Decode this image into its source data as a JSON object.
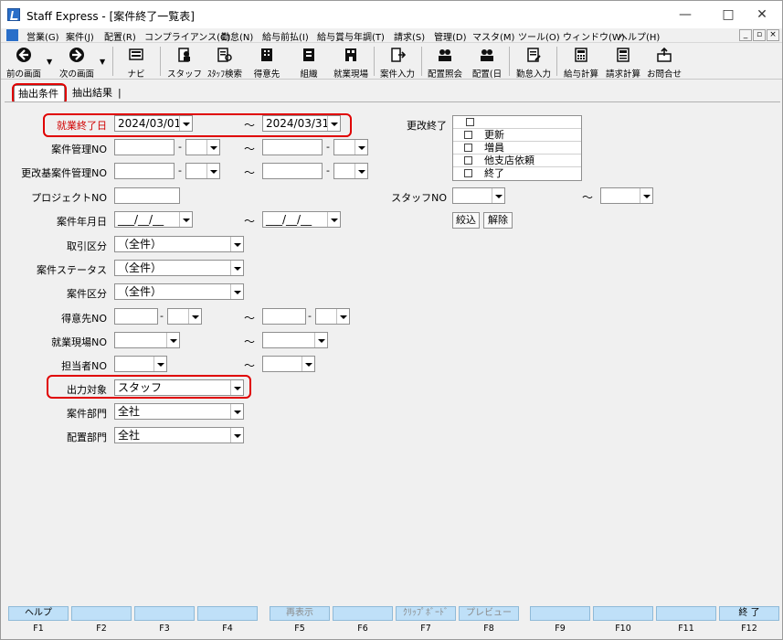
{
  "window": {
    "title": "Staff Express - [案件終了一覧表]"
  },
  "menu": [
    "営業(G)",
    "案件(J)",
    "配置(R)",
    "コンプライアンス(C)",
    "勤怠(N)",
    "給与前払(I)",
    "給与賞与年調(T)",
    "請求(S)",
    "管理(D)",
    "マスタ(M)",
    "ツール(O)",
    "ウィンドウ(W)",
    "ヘルプ(H)"
  ],
  "toolbar": [
    {
      "label": "前の画面",
      "icon": "back-arrow-icon"
    },
    {
      "label": "次の画面",
      "icon": "forward-arrow-icon"
    },
    {
      "label": "ナビ",
      "icon": "navi-icon"
    },
    {
      "label": "スタッフ",
      "icon": "staff-icon"
    },
    {
      "label": "ｽﾀｯﾌ検索",
      "icon": "staff-search-icon"
    },
    {
      "label": "得意先",
      "icon": "client-icon"
    },
    {
      "label": "組織",
      "icon": "organization-icon"
    },
    {
      "label": "就業現場",
      "icon": "worksite-icon"
    },
    {
      "label": "案件入力",
      "icon": "project-entry-icon"
    },
    {
      "label": "配置照会",
      "icon": "placement-inquiry-icon"
    },
    {
      "label": "配置(日",
      "icon": "placement-daily-icon"
    },
    {
      "label": "勤怠入力",
      "icon": "attendance-entry-icon"
    },
    {
      "label": "給与計算",
      "icon": "payroll-icon"
    },
    {
      "label": "請求計算",
      "icon": "billing-icon"
    },
    {
      "label": "お問合せ",
      "icon": "inquiry-icon"
    }
  ],
  "tabs": [
    "抽出条件",
    "抽出結果"
  ],
  "form": {
    "shugyo_end_label": "就業終了日",
    "shugyo_end_from": "2024/03/01",
    "shugyo_end_to": "2024/03/31",
    "anken_kanri_label": "案件管理NO",
    "koukai_moto_label": "更改基案件管理NO",
    "project_label": "プロジェクトNO",
    "anken_date_label": "案件年月日",
    "date_placeholder": "___/__/__",
    "torihiki_label": "取引区分",
    "torihiki_value": "（全件）",
    "status_label": "案件ステータス",
    "status_value": "（全件）",
    "kubun_label": "案件区分",
    "kubun_value": "（全件）",
    "tokui_label": "得意先NO",
    "genba_label": "就業現場NO",
    "tanto_label": "担当者NO",
    "output_label": "出力対象",
    "output_value": "スタッフ",
    "anken_bumon_label": "案件部門",
    "anken_bumon_value": "全社",
    "haichi_bumon_label": "配置部門",
    "haichi_bumon_value": "全社",
    "koukai_end_label": "更改終了",
    "koukai_options": [
      "",
      "更新",
      "増員",
      "他支店依頼",
      "終了"
    ],
    "staff_label": "スタッフNO",
    "filter_button": "絞込",
    "clear_button": "解除",
    "dash": "-",
    "tilde": "～"
  },
  "fkeys": [
    {
      "label": "ヘルプ",
      "code": "F1",
      "enabled": true
    },
    {
      "label": "",
      "code": "F2",
      "enabled": true
    },
    {
      "label": "",
      "code": "F3",
      "enabled": true
    },
    {
      "label": "",
      "code": "F4",
      "enabled": true
    },
    {
      "label": "再表示",
      "code": "F5",
      "enabled": false
    },
    {
      "label": "",
      "code": "F6",
      "enabled": true
    },
    {
      "label": "ｸﾘｯﾌﾟﾎﾞｰﾄﾞ",
      "code": "F7",
      "enabled": false
    },
    {
      "label": "プレビュー",
      "code": "F8",
      "enabled": false
    },
    {
      "label": "",
      "code": "F9",
      "enabled": true
    },
    {
      "label": "",
      "code": "F10",
      "enabled": true
    },
    {
      "label": "",
      "code": "F11",
      "enabled": true
    },
    {
      "label": "終 了",
      "code": "F12",
      "enabled": true
    }
  ]
}
